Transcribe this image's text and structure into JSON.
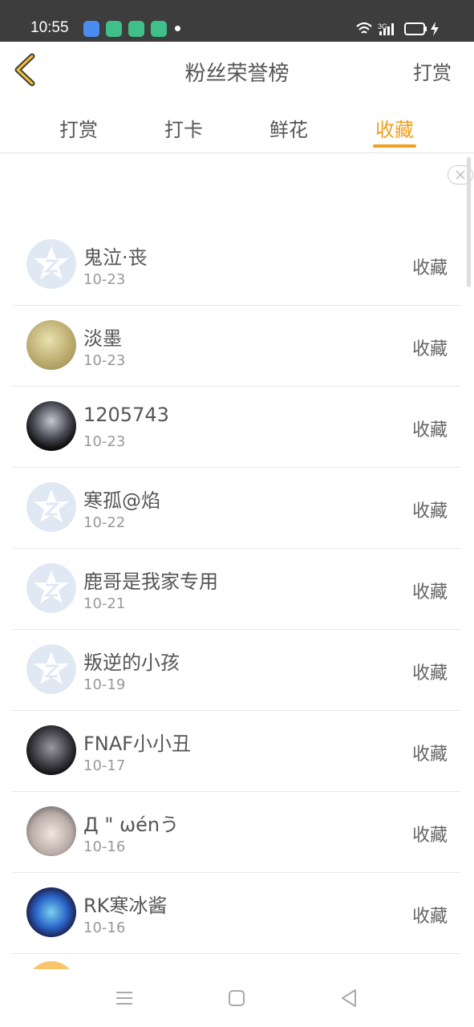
{
  "status_bar": {
    "time": "10:55",
    "network": "3G"
  },
  "header": {
    "title": "粉丝荣誉榜",
    "right_action": "打赏"
  },
  "tabs": [
    {
      "label": "打赏",
      "active": false
    },
    {
      "label": "打卡",
      "active": false
    },
    {
      "label": "鲜花",
      "active": false
    },
    {
      "label": "收藏",
      "active": true
    }
  ],
  "colors": {
    "accent": "#f0a020",
    "status_bar": "#3d3d3d"
  },
  "rows": [
    {
      "name": "鬼泣·丧",
      "date": "10-23",
      "action": "收藏",
      "avatar": "default-qq-icon"
    },
    {
      "name": "淡墨",
      "date": "10-23",
      "action": "收藏",
      "avatar": "photo-avatar"
    },
    {
      "name": "1205743",
      "date": "10-23",
      "action": "收藏",
      "avatar": "photo-avatar"
    },
    {
      "name": "寒孤@焰",
      "date": "10-22",
      "action": "收藏",
      "avatar": "default-qq-icon"
    },
    {
      "name": "鹿哥是我家专用",
      "date": "10-21",
      "action": "收藏",
      "avatar": "default-qq-icon"
    },
    {
      "name": "叛逆的小孩",
      "date": "10-19",
      "action": "收藏",
      "avatar": "default-qq-icon"
    },
    {
      "name": "FNAF小小丑",
      "date": "10-17",
      "action": "收藏",
      "avatar": "photo-avatar"
    },
    {
      "name": "Д \" ωénう",
      "date": "10-16",
      "action": "收藏",
      "avatar": "photo-avatar"
    },
    {
      "name": "RK寒冰酱",
      "date": "10-16",
      "action": "收藏",
      "avatar": "photo-avatar"
    }
  ]
}
